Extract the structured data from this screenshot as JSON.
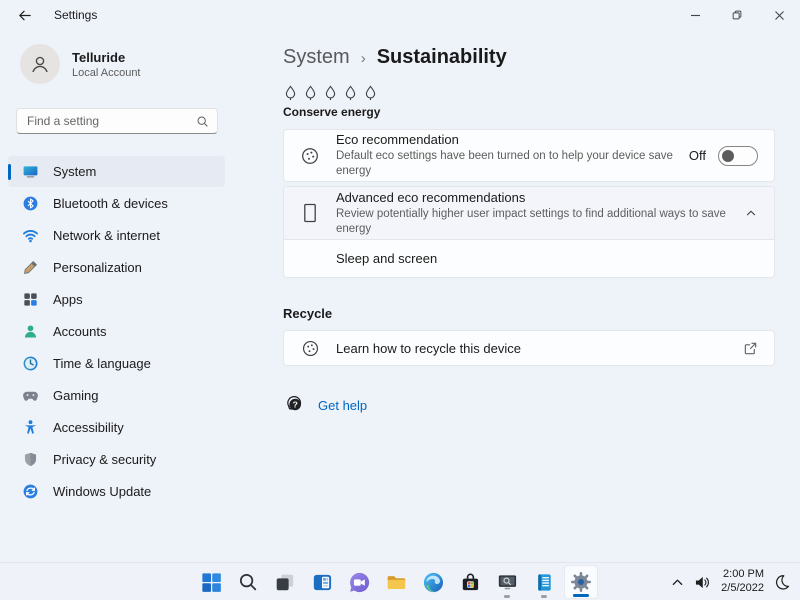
{
  "window": {
    "title": "Settings",
    "controls": [
      "minimize-icon",
      "restore-icon",
      "close-icon"
    ]
  },
  "sidebar": {
    "user": {
      "name": "Telluride",
      "type": "Local Account"
    },
    "search": {
      "placeholder": "Find a setting"
    },
    "items": [
      {
        "label": "System",
        "icon": "system-icon",
        "selected": true
      },
      {
        "label": "Bluetooth & devices",
        "icon": "bluetooth-icon",
        "selected": false
      },
      {
        "label": "Network & internet",
        "icon": "network-icon",
        "selected": false
      },
      {
        "label": "Personalization",
        "icon": "personalization-icon",
        "selected": false
      },
      {
        "label": "Apps",
        "icon": "apps-icon",
        "selected": false
      },
      {
        "label": "Accounts",
        "icon": "accounts-icon",
        "selected": false
      },
      {
        "label": "Time & language",
        "icon": "time-language-icon",
        "selected": false
      },
      {
        "label": "Gaming",
        "icon": "gaming-icon",
        "selected": false
      },
      {
        "label": "Accessibility",
        "icon": "accessibility-icon",
        "selected": false
      },
      {
        "label": "Privacy & security",
        "icon": "privacy-icon",
        "selected": false
      },
      {
        "label": "Windows Update",
        "icon": "windows-update-icon",
        "selected": false
      }
    ]
  },
  "main": {
    "breadcrumb": {
      "parent": "System",
      "separator": "›",
      "current": "Sustainability"
    },
    "decoration": {
      "leaf_icon_count": 5
    },
    "conserve": {
      "header": "Conserve energy",
      "eco": {
        "title": "Eco recommendation",
        "description": "Default eco settings have been turned on to help your device save energy",
        "toggle_label": "Off",
        "toggle_state": "off"
      },
      "advanced": {
        "title": "Advanced eco recommendations",
        "description": "Review potentially higher user impact settings to find additional ways to save energy",
        "expanded": true,
        "children": [
          {
            "label": "Sleep and screen"
          }
        ]
      }
    },
    "recycle": {
      "header": "Recycle",
      "link_label": "Learn how to recycle this device"
    },
    "get_help_label": "Get help"
  },
  "taskbar": {
    "icons": [
      "start-icon",
      "search-icon",
      "task-view-icon",
      "widgets-icon",
      "chat-icon",
      "file-explorer-icon",
      "edge-icon",
      "store-icon",
      "app-monitor-icon",
      "app-notes-icon",
      "settings-gear-icon"
    ],
    "running_apps": [
      "app-monitor",
      "app-notes",
      "settings"
    ],
    "active_app": "settings",
    "tray": {
      "time": "2:00 PM",
      "date": "2/5/2022",
      "icons": [
        "hidden-icons-chevron-icon",
        "speaker-icon",
        "do-not-disturb-moon-icon"
      ]
    }
  },
  "colors": {
    "accent": "#0067c0",
    "link": "#0067c0",
    "background": "#eef2f9",
    "card": "#fcfdfe",
    "toggle_knob_off": "#5c5c5c"
  }
}
